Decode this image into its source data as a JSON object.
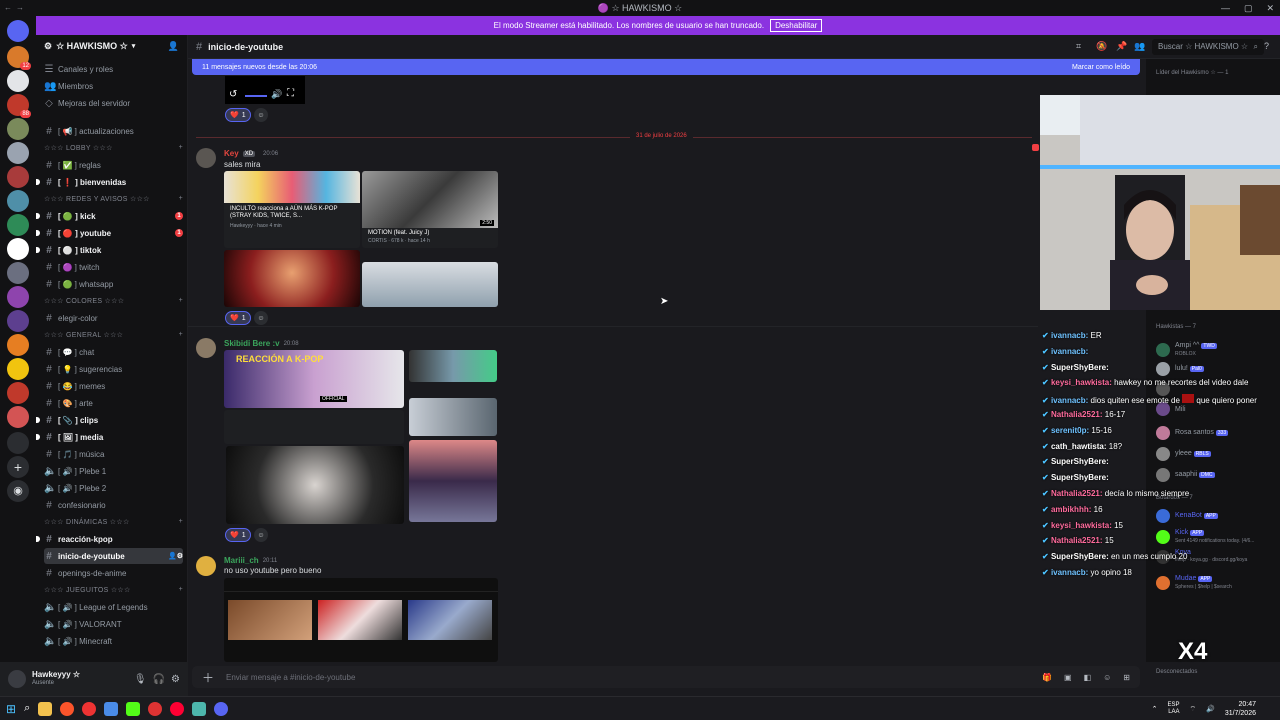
{
  "titlebar": {
    "title": "🟣 ☆ HAWKISMO ☆",
    "ctrls": [
      "—",
      "▢",
      "✕"
    ]
  },
  "banner": {
    "text": "El modo Streamer está habilitado. Los nombres de usuario se han truncado.",
    "button": "Deshabilitar"
  },
  "guild": {
    "name": "☆ HAWKISMO ☆"
  },
  "sidebar": {
    "top_items": [
      "Canales y roles",
      "Miembros",
      "Mejoras del servidor"
    ],
    "rows": [
      {
        "kind": "channel",
        "label": "[ 📢 ] actualizaciones",
        "bold": false
      },
      {
        "kind": "category",
        "label": "☆☆☆ LOBBY ☆☆☆"
      },
      {
        "kind": "channel",
        "label": "[ ✅ ] reglas",
        "bold": false
      },
      {
        "kind": "channel",
        "label": "[ ❗ ] bienvenidas",
        "bold": true
      },
      {
        "kind": "category",
        "label": "☆☆☆ REDES Y AVISOS ☆☆☆"
      },
      {
        "kind": "channel",
        "label": "[ 🟢 ] kick",
        "bold": true,
        "badge": "1"
      },
      {
        "kind": "channel",
        "label": "[ 🔴 ] youtube",
        "bold": true,
        "badge": "1"
      },
      {
        "kind": "channel",
        "label": "[ ⚪ ] tiktok",
        "bold": true
      },
      {
        "kind": "channel",
        "label": "[ 🟣 ] twitch",
        "bold": false
      },
      {
        "kind": "channel",
        "label": "[ 🟢 ] whatsapp",
        "bold": false
      },
      {
        "kind": "category",
        "label": "☆☆☆ COLORES ☆☆☆"
      },
      {
        "kind": "channel",
        "label": "elegir-color",
        "bold": false
      },
      {
        "kind": "category",
        "label": "☆☆☆ GENERAL ☆☆☆"
      },
      {
        "kind": "channel",
        "label": "[ 💬 ] chat",
        "bold": false
      },
      {
        "kind": "channel",
        "label": "[ 💡 ] sugerencias",
        "bold": false
      },
      {
        "kind": "channel",
        "label": "[ 😂 ] memes",
        "bold": false
      },
      {
        "kind": "channel",
        "label": "[ 🎨 ] arte",
        "bold": false
      },
      {
        "kind": "channel",
        "label": "[ 📎 ] clips",
        "bold": true
      },
      {
        "kind": "channel",
        "label": "[ 🖼 ] media",
        "bold": true
      },
      {
        "kind": "channel",
        "label": "[ 🎵 ] música",
        "bold": false
      },
      {
        "kind": "voice",
        "label": "[ 🔊 ] Plebe 1",
        "bold": false
      },
      {
        "kind": "voice",
        "label": "[ 🔊 ] Plebe 2",
        "bold": false
      },
      {
        "kind": "channel",
        "label": "confesionario",
        "bold": false
      },
      {
        "kind": "category",
        "label": "☆☆☆ DINÁMICAS ☆☆☆"
      },
      {
        "kind": "channel",
        "label": "reacción-kpop",
        "bold": true
      },
      {
        "kind": "channel",
        "label": "inicio-de-youtube",
        "bold": true,
        "active": true
      },
      {
        "kind": "channel",
        "label": "openings-de-anime",
        "bold": false
      },
      {
        "kind": "category",
        "label": "☆☆☆ JUEGUITOS ☆☆☆"
      },
      {
        "kind": "voice",
        "label": "[ 🔊 ] League of Legends",
        "bold": false
      },
      {
        "kind": "voice",
        "label": "[ 🔊 ] VALORANT",
        "bold": false
      },
      {
        "kind": "voice",
        "label": "[ 🔊 ] Minecraft",
        "bold": false
      }
    ]
  },
  "user": {
    "name": "Hawkeyyy ☆",
    "status": "Ausente"
  },
  "chat": {
    "channel": "inicio-de-youtube",
    "search_placeholder": "Buscar ☆ HAWKISMO ☆",
    "new_messages": "11 mensajes nuevos desde las 20:06",
    "mark_read": "Marcar como leído",
    "date_divider": "31 de julio de 2026",
    "messages": [
      {
        "author": "Key",
        "badge": "XD",
        "time": "20:06",
        "text": "sales mira",
        "author_color": "#e4463f",
        "reaction_count": "1",
        "cards": [
          {
            "title": "INCULTO reacciona a AÚN MÁS K-POP (STRAY KIDS, TWICE, S...",
            "meta": "Hawkeyyy · hace 4 min"
          },
          {
            "title": "MOTION (feat. Juicy J)",
            "meta": "CORTIS · 678 k · hace 14 h",
            "duration": "2:50"
          }
        ]
      },
      {
        "author": "Skibidi Bere :v",
        "time": "20:08",
        "text": "",
        "author_color": "#3ba55c",
        "reaction_count": "1",
        "overlay_text": "REACCIÓN A K-POP",
        "tag": "OFFICIAL"
      },
      {
        "author": "Mariii_ch",
        "time": "20:11",
        "text": "no uso youtube pero bueno",
        "author_color": "#3ba55c"
      }
    ],
    "composer_placeholder": "Enviar mensaje a #inicio-de-youtube",
    "top_reaction_count": "1"
  },
  "stream_chat": [
    {
      "user": "ivannacb:",
      "text": "ER",
      "color": "#6fc2ff"
    },
    {
      "user": "ivannacb:",
      "text": "",
      "color": "#6fc2ff"
    },
    {
      "user": "SuperShyBere:",
      "text": "",
      "color": "#ffffff"
    },
    {
      "user": "keysi_hawkista:",
      "text": "hawkey no me recortes del video dale",
      "color": "#ff6b9d"
    },
    {
      "user": "ivannacb:",
      "text": "dios quiten ese emote de",
      "text2": "que quiero poner",
      "color": "#6fc2ff"
    },
    {
      "user": "Nathalia2521:",
      "text": "16-17",
      "color": "#ff6b9d"
    },
    {
      "user": "serenit0p:",
      "text": "15-16",
      "color": "#6fc2ff"
    },
    {
      "user": "cath_hawtista:",
      "text": "18?",
      "color": "#ffffff"
    },
    {
      "user": "SuperShyBere:",
      "text": "",
      "color": "#ffffff"
    },
    {
      "user": "SuperShyBere:",
      "text": "",
      "color": "#ffffff"
    },
    {
      "user": "Nathalia2521:",
      "text": "decía lo mismo siempre",
      "color": "#ff6b9d"
    },
    {
      "user": "ambikhhh:",
      "text": "16",
      "color": "#ff6b9d"
    },
    {
      "user": "keysi_hawkista:",
      "text": "15",
      "color": "#ff6b9d"
    },
    {
      "user": "Nathalia2521:",
      "text": "15",
      "color": "#ff6b9d"
    },
    {
      "user": "SuperShyBere:",
      "text": "en un mes cumplo 20",
      "color": "#ffffff"
    },
    {
      "user": "ivannacb:",
      "text": "yo opino 18",
      "color": "#6fc2ff"
    }
  ],
  "members": {
    "sec1": "Líder del Hawkismo ☆ — 1",
    "sec2": "Hawkistas — 7",
    "sec3": "Botardos — 7",
    "sec4": "Desconectados",
    "list": [
      {
        "name": "Ampi ^^",
        "sub": "ROBLOX",
        "tag": "TWD",
        "color": "#949ba4"
      },
      {
        "name": "lulu!",
        "tag": "Pal0",
        "color": "#949ba4"
      },
      {
        "name": "",
        "color": "#949ba4"
      },
      {
        "name": "Mili",
        "color": "#949ba4"
      },
      {
        "name": "Rosa santos",
        "tag": "333",
        "color": "#949ba4"
      },
      {
        "name": "yleee",
        "tag": "RBLS",
        "color": "#949ba4"
      },
      {
        "name": "saaphii",
        "tag": "DMC",
        "color": "#949ba4"
      },
      {
        "name": "KenaBot",
        "tag": "APP",
        "color": "#5865f2"
      },
      {
        "name": "Kick",
        "tag": "APP",
        "sub": "Sent 4149 notifications today. (4/6...",
        "color": "#5865f2"
      },
      {
        "name": "Koya",
        "sub": "/help · koya.gg · discord.gg/koya",
        "color": "#5865f2"
      },
      {
        "name": "Mudae",
        "tag": "APP",
        "sub": "Spheres | $help | $search",
        "color": "#5865f2"
      }
    ],
    "overlay_text": "X4"
  },
  "clock": {
    "lang": "ESP",
    "lang2": "LAA",
    "time": "20:47",
    "date": "31/7/2026"
  }
}
